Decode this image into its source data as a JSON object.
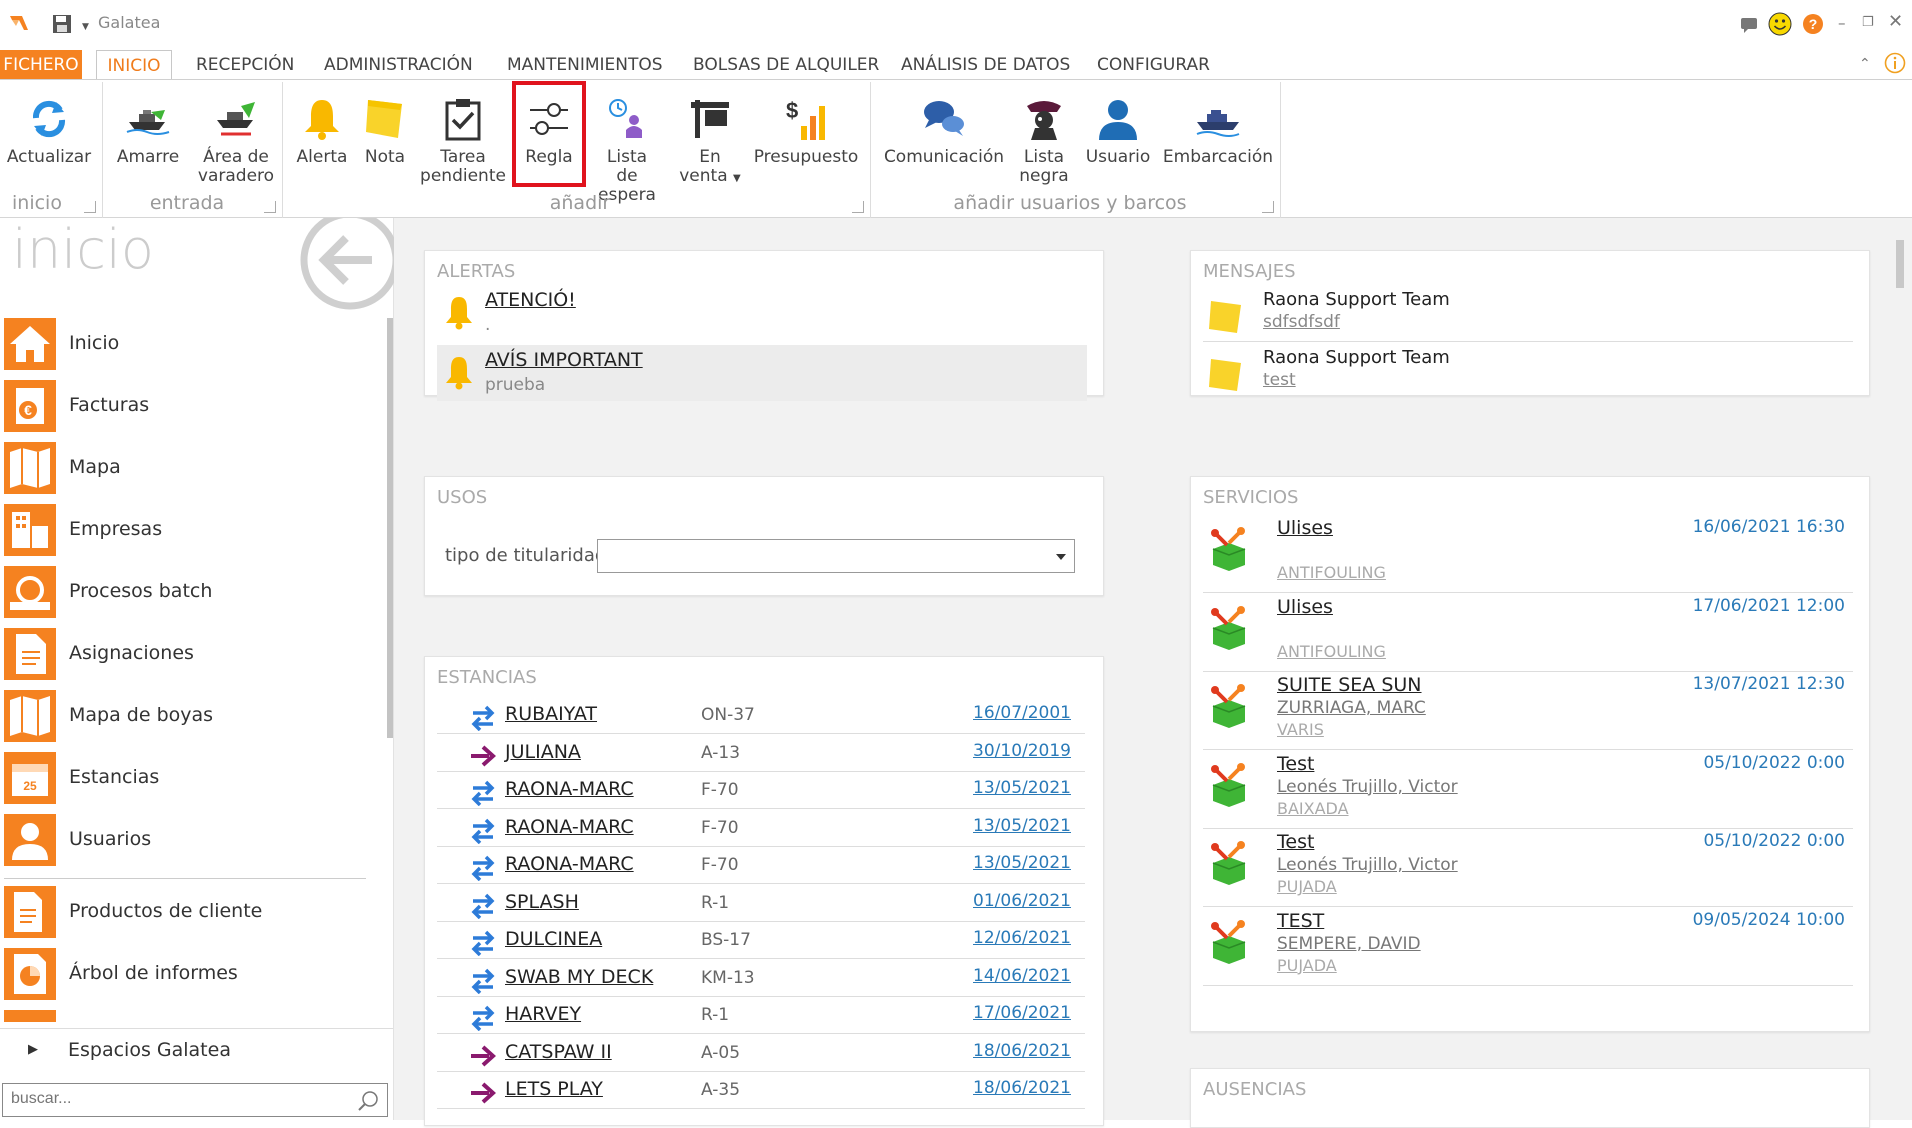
{
  "window": {
    "title": "Galatea"
  },
  "tabs": [
    "FICHERO",
    "INICIO",
    "RECEPCIÓN",
    "ADMINISTRACIÓN",
    "MANTENIMIENTOS",
    "BOLSAS DE ALQUILER",
    "ANÁLISIS DE DATOS",
    "CONFIGURAR"
  ],
  "ribbon": {
    "buttons": {
      "actualizar": "Actualizar",
      "amarre": "Amarre",
      "area_l1": "Área de",
      "area_l2": "varadero",
      "alerta": "Alerta",
      "nota": "Nota",
      "tarea_l1": "Tarea",
      "tarea_l2": "pendiente",
      "regla": "Regla",
      "lista_l1": "Lista",
      "lista_l2": "de espera",
      "venta_l1": "En",
      "venta_l2": "venta",
      "presupuesto": "Presupuesto",
      "comunicacion": "Comunicación",
      "negra_l1": "Lista",
      "negra_l2": "negra",
      "usuario": "Usuario",
      "embarcacion": "Embarcación"
    },
    "groups": {
      "inicio": "inicio",
      "entrada": "entrada",
      "anadir": "añadir",
      "usuarios": "añadir usuarios y barcos"
    }
  },
  "sidebar": {
    "title": "inicio",
    "items": [
      "Inicio",
      "Facturas",
      "Mapa",
      "Empresas",
      "Procesos batch",
      "Asignaciones",
      "Mapa de boyas",
      "Estancias",
      "Usuarios",
      "Productos de cliente",
      "Árbol de informes"
    ],
    "spaces": "Espacios Galatea",
    "search_placeholder": "buscar..."
  },
  "alertas": {
    "title": "ALERTAS",
    "items": [
      {
        "title": "ATENCIÓ!",
        "sub": "."
      },
      {
        "title": "AVÍS IMPORTANT",
        "sub": "prueba"
      }
    ]
  },
  "mensajes": {
    "title": "MENSAJES",
    "items": [
      {
        "from": "Raona Support Team",
        "text": "sdfsdfsdf"
      },
      {
        "from": "Raona Support Team",
        "text": "test"
      }
    ]
  },
  "usos": {
    "title": "USOS",
    "label": "tipo de titularidad",
    "value": ""
  },
  "estancias": {
    "title": "ESTANCIAS",
    "rows": [
      {
        "name": "RUBAIYAT",
        "code": "ON-37",
        "date": "16/07/2001",
        "type": "swap"
      },
      {
        "name": "JULIANA",
        "code": "A-13",
        "date": "30/10/2019",
        "type": "in"
      },
      {
        "name": "RAONA-MARC",
        "code": "F-70",
        "date": "13/05/2021",
        "type": "swap"
      },
      {
        "name": "RAONA-MARC",
        "code": "F-70",
        "date": "13/05/2021",
        "type": "swap"
      },
      {
        "name": "RAONA-MARC",
        "code": "F-70",
        "date": "13/05/2021",
        "type": "swap"
      },
      {
        "name": "SPLASH",
        "code": "R-1",
        "date": "01/06/2021",
        "type": "swap"
      },
      {
        "name": "DULCINEA",
        "code": "BS-17",
        "date": "12/06/2021",
        "type": "swap"
      },
      {
        "name": "SWAB MY DECK",
        "code": "KM-13",
        "date": "14/06/2021",
        "type": "swap"
      },
      {
        "name": "HARVEY",
        "code": "R-1",
        "date": "17/06/2021",
        "type": "swap"
      },
      {
        "name": "CATSPAW II",
        "code": "A-05",
        "date": "18/06/2021",
        "type": "in"
      },
      {
        "name": "LETS PLAY",
        "code": "A-35",
        "date": "18/06/2021",
        "type": "in"
      }
    ]
  },
  "servicios": {
    "title": "SERVICIOS",
    "rows": [
      {
        "name": "Ulises",
        "line1": "",
        "line2": "ANTIFOULING",
        "date": "16/06/2021 16:30"
      },
      {
        "name": "Ulises",
        "line1": "",
        "line2": "ANTIFOULING",
        "date": "17/06/2021 12:00"
      },
      {
        "name": "SUITE SEA SUN",
        "line1": "ZURRIAGA, MARC",
        "line2": "VARIS",
        "date": "13/07/2021 12:30"
      },
      {
        "name": "Test",
        "line1": "Leonés Trujillo, Victor",
        "line2": "BAIXADA",
        "date": "05/10/2022 0:00"
      },
      {
        "name": "Test",
        "line1": "Leonés Trujillo, Victor",
        "line2": "PUJADA",
        "date": "05/10/2022 0:00"
      },
      {
        "name": "TEST",
        "line1": "SEMPERE, DAVID",
        "line2": "PUJADA",
        "date": "09/05/2024 10:00"
      }
    ]
  },
  "ausencias": {
    "title": "AUSENCIAS"
  },
  "colors": {
    "accent": "#f58220",
    "link": "#2a7ab8",
    "highlight": "#e0131d",
    "swap_arrow": "#2d7bd8",
    "in_arrow": "#8a1a6e"
  }
}
